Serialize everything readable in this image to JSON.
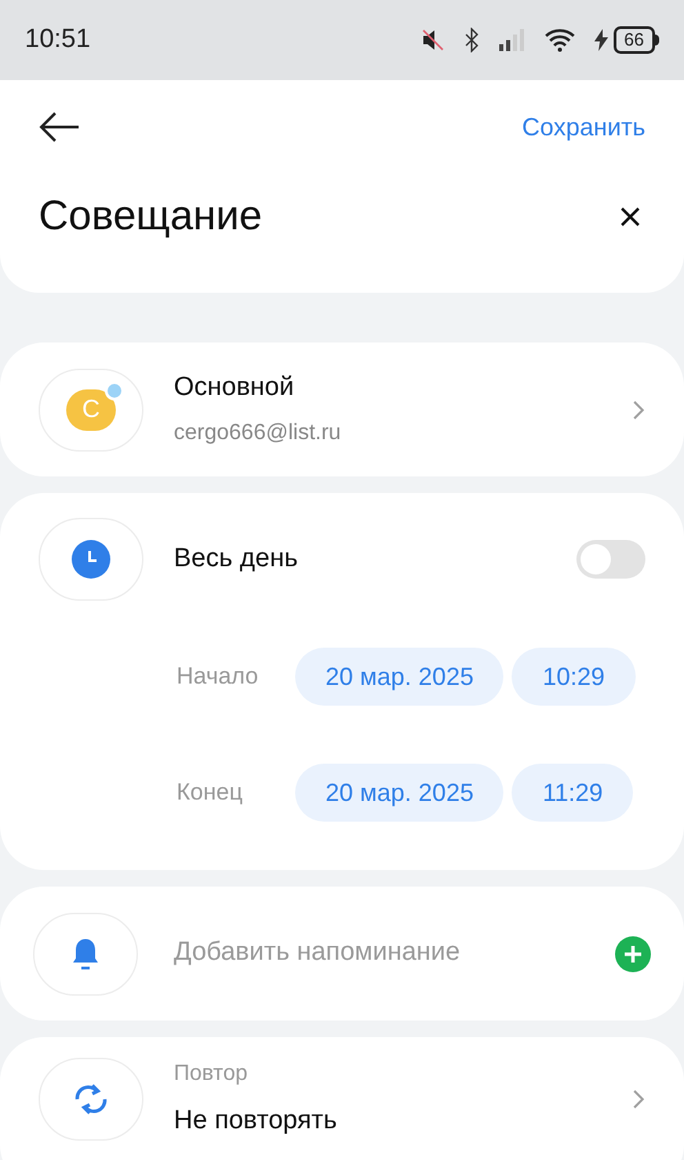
{
  "status_bar": {
    "time": "10:51",
    "battery": "66"
  },
  "header": {
    "save": "Сохранить",
    "title": "Совещание"
  },
  "calendar": {
    "avatar_letter": "C",
    "name": "Основной",
    "email": "cergo666@list.ru"
  },
  "all_day": {
    "label": "Весь день",
    "on": false
  },
  "times": [
    {
      "label": "Начало",
      "date": "20 мар. 2025",
      "time": "10:29"
    },
    {
      "label": "Конец",
      "date": "20 мар. 2025",
      "time": "11:29"
    }
  ],
  "reminder": {
    "placeholder": "Добавить напоминание"
  },
  "repeat": {
    "label": "Повтор",
    "value": "Не повторять"
  }
}
